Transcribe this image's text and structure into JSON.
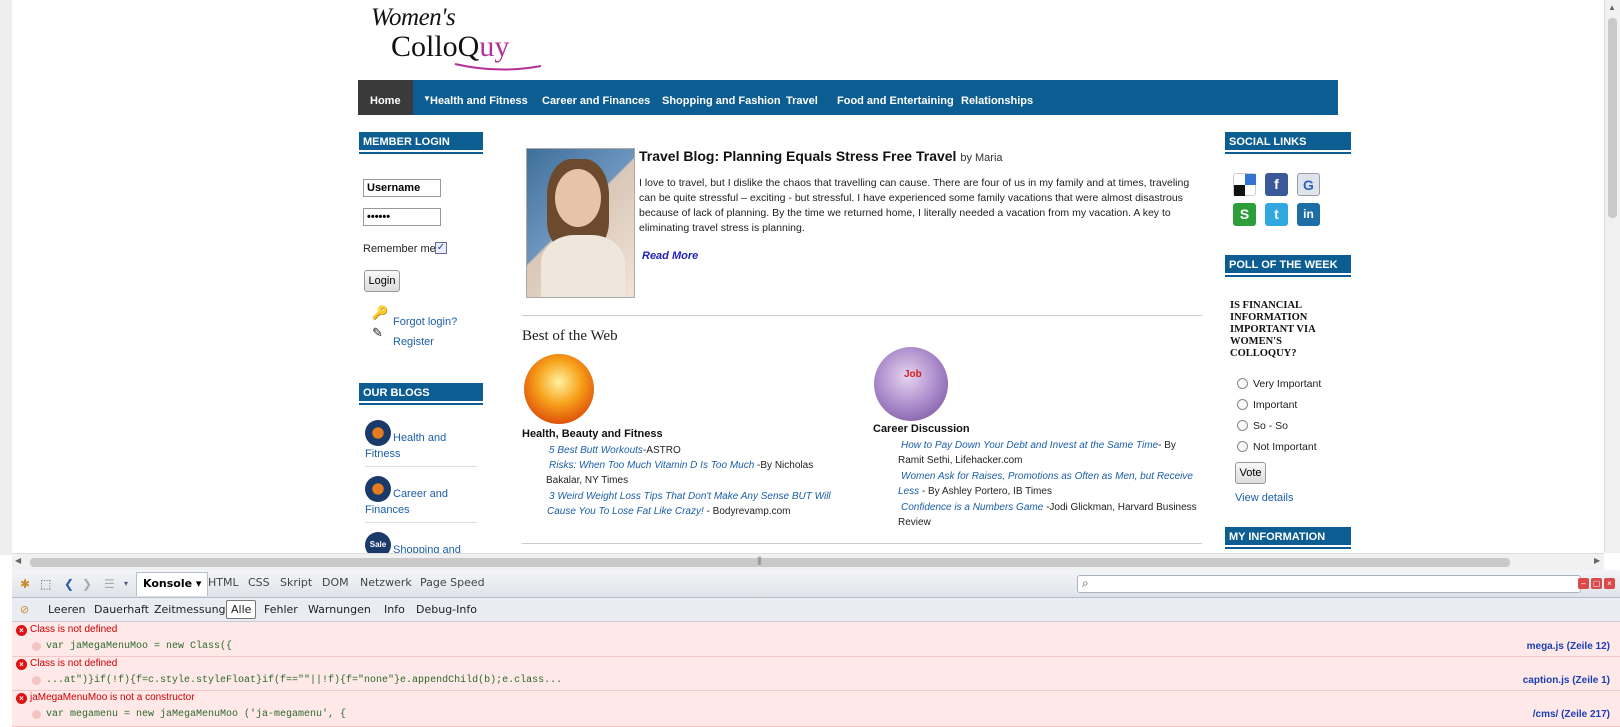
{
  "logo": {
    "line1": "Women's",
    "line2_pre": "ColloQ",
    "line2_accent": "uy"
  },
  "nav": {
    "items": [
      {
        "label": "Home"
      },
      {
        "label": "Health and Fitness"
      },
      {
        "label": "Career and Finances"
      },
      {
        "label": "Shopping and Fashion"
      },
      {
        "label": "Travel"
      },
      {
        "label": "Food and Entertaining"
      },
      {
        "label": "Relationships"
      }
    ]
  },
  "login": {
    "header": "MEMBER LOGIN",
    "username_value": "Username",
    "password_value": "••••••",
    "remember_label": "Remember me",
    "login_button": "Login",
    "forgot_link": "Forgot login?",
    "register_link": "Register"
  },
  "blogs": {
    "header": "OUR BLOGS",
    "items": [
      {
        "label": "Health and Fitness"
      },
      {
        "label": "Career and Finances"
      },
      {
        "label": "Shopping and",
        "icon_text": "Sale"
      }
    ]
  },
  "article": {
    "title": "Travel Blog: Planning Equals Stress Free Travel",
    "byline": "by Maria",
    "text": "I love to travel, but I dislike the chaos that travelling can cause. There are four of us in my family and at times, traveling can be quite stressful – exciting - but stressful. I have experienced some family vacations that were almost disastrous because of lack of planning. By the time we returned home, I literally needed a vacation from my vacation. A key to eliminating travel stress is planning.",
    "read_more": "Read More"
  },
  "best_of_web": {
    "title": "Best of the Web",
    "health": {
      "title": "Health, Beauty and Fitness",
      "items": [
        {
          "link": "5 Best Butt Workouts",
          "source": "-ASTRO"
        },
        {
          "link": "Risks: When Too Much Vitamin D Is Too Much",
          "source": " -By Nicholas Bakalar, NY Times"
        },
        {
          "link": "3 Weird Weight Loss Tips That Don't Make Any Sense BUT Will Cause You To Lose Fat Like Crazy!",
          "source": " - Bodyrevamp.com"
        }
      ]
    },
    "career": {
      "title": "Career Discussion",
      "icon_text": "Job",
      "items": [
        {
          "link": "How to Pay Down Your Debt and Invest at the Same Time",
          "source": "- By Ramit Sethi, Lifehacker.com"
        },
        {
          "link": "Women Ask for Raises, Promotions as Often as Men, but Receive Less",
          "source": " - By Ashley Portero, IB Times"
        },
        {
          "link": "Confidence is a Numbers Game",
          "source": " -Jodi Glickman, Harvard Business Review"
        }
      ]
    }
  },
  "social": {
    "header": "SOCIAL LINKS",
    "icons": [
      {
        "name": "delicious-icon",
        "color": "#ffffff"
      },
      {
        "name": "facebook-icon",
        "glyph": "f",
        "color": "#3b5998"
      },
      {
        "name": "google-icon",
        "glyph": "G",
        "color": "#dfe3ea"
      },
      {
        "name": "stumbleupon-icon",
        "glyph": "S",
        "color": "#2d9e3a"
      },
      {
        "name": "twitter-icon",
        "glyph": "t",
        "color": "#31a7e0"
      },
      {
        "name": "linkedin-icon",
        "glyph": "in",
        "color": "#1c6ea4"
      }
    ]
  },
  "poll": {
    "header": "POLL OF THE WEEK",
    "question": "IS FINANCIAL INFORMATION IMPORTANT VIA WOMEN'S COLLOQUY?",
    "options": [
      "Very Important",
      "Important",
      "So - So",
      "Not Important"
    ],
    "vote_button": "Vote",
    "details_link": "View details"
  },
  "my_info": {
    "header": "MY INFORMATION"
  },
  "firebug": {
    "tabs": [
      "Konsole",
      "HTML",
      "CSS",
      "Skript",
      "DOM",
      "Netzwerk",
      "Page Speed"
    ],
    "filters": [
      "Leeren",
      "Dauerhaft",
      "Zeitmessung",
      "Alle",
      "Fehler",
      "Warnungen",
      "Info",
      "Debug-Info"
    ],
    "search_placeholder": "",
    "errors": [
      {
        "message": "Class is not defined",
        "code": "var jaMegaMenuMoo = new Class({",
        "source": "mega.js (Zeile 12)"
      },
      {
        "message": "Class is not defined",
        "code": "...at\")}if(!f){f=c.style.styleFloat}if(f==\"\"||!f){f=\"none\"}e.appendChild(b);e.class...",
        "source": "caption.js (Zeile 1)"
      },
      {
        "message": "jaMegaMenuMoo is not a constructor",
        "code": "var megamenu = new jaMegaMenuMoo ('ja-megamenu', {",
        "source": "/cms/ (Zeile 217)"
      }
    ]
  },
  "colors": {
    "brand_blue": "#0c5d92",
    "accent_purple": "#b0319a",
    "error_red": "#cc0000"
  }
}
